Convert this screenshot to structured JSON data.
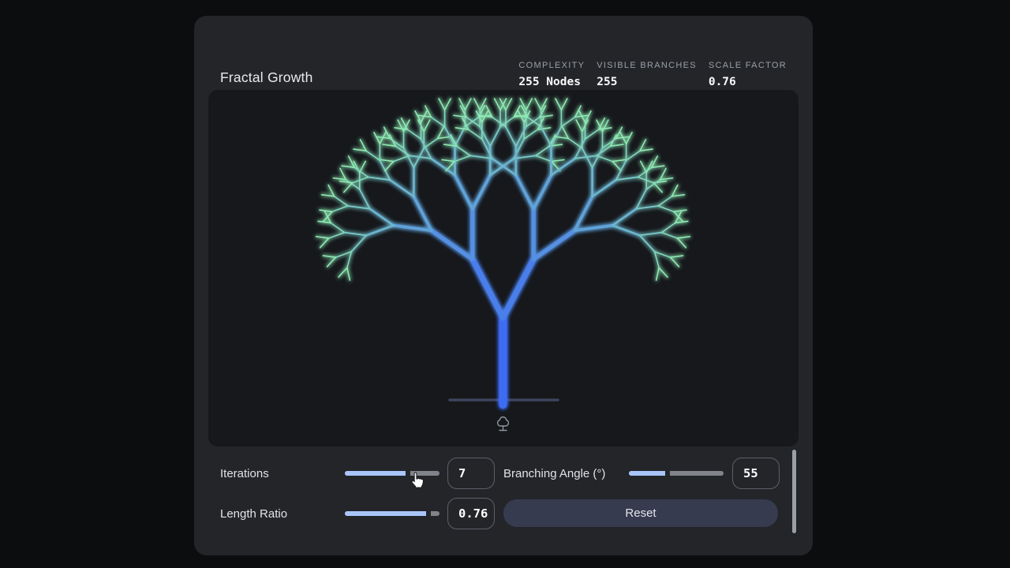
{
  "app": {
    "title": "Fractal Growth"
  },
  "stats": [
    {
      "label": "COMPLEXITY",
      "value": "255 Nodes"
    },
    {
      "label": "VISIBLE BRANCHES",
      "value": "255"
    },
    {
      "label": "SCALE FACTOR",
      "value": "0.76"
    }
  ],
  "controls": {
    "iterations": {
      "label": "Iterations",
      "value": "7",
      "percent": 67
    },
    "branching_angle": {
      "label": "Branching Angle (°)",
      "value": "55",
      "percent": 41
    },
    "length_ratio": {
      "label": "Length Ratio",
      "value": "0.76",
      "percent": 88
    },
    "reset_label": "Reset"
  },
  "fractal": {
    "levels": 8,
    "nodes": 255,
    "branching_angle_deg": 55,
    "length_ratio": 0.76,
    "trunk_color": "#3d6cf4",
    "tip_color": "#8feab4",
    "trunk_width": 10,
    "width_decay": 0.72,
    "ground_color": "#3e445c",
    "icon_color": "#9095a0"
  },
  "colors": {
    "accent_blue": "#a9c6fa",
    "card_bg": "#232529",
    "canvas_bg": "#16181c",
    "button_bg": "#363b4f"
  }
}
